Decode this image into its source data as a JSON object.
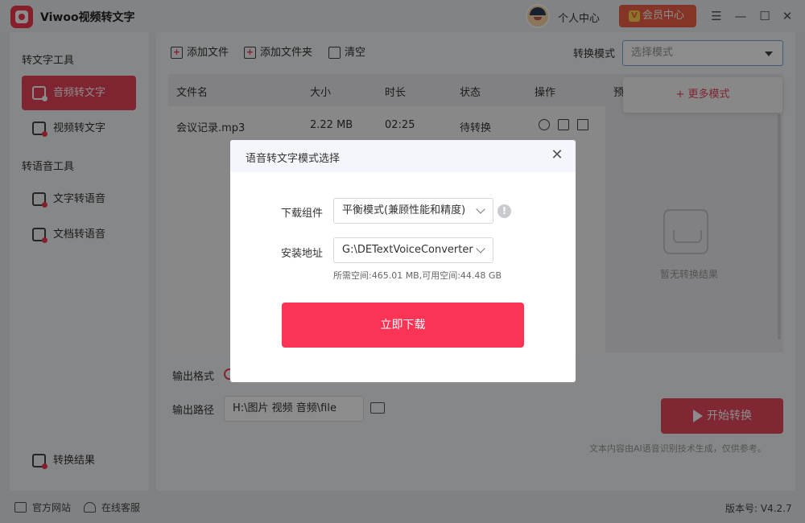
{
  "app": {
    "title": "Viwoo视频转文字"
  },
  "header": {
    "personal_center": "个人中心",
    "vip_center": "会员中心"
  },
  "sidebar": {
    "section_text_tools": "转文字工具",
    "section_voice_tools": "转语音工具",
    "items": [
      {
        "label": "音频转文字",
        "active": true
      },
      {
        "label": "视频转文字",
        "active": false
      },
      {
        "label": "文字转语音",
        "active": false
      },
      {
        "label": "文档转语音",
        "active": false
      }
    ],
    "results": "转换结果"
  },
  "toolbar": {
    "add_file": "添加文件",
    "add_folder": "添加文件夹",
    "clear": "清空"
  },
  "mode": {
    "label": "转换模式",
    "placeholder": "选择模式",
    "more": "+ 更多模式"
  },
  "table": {
    "headers": [
      "文件名",
      "大小",
      "时长",
      "状态",
      "操作"
    ],
    "rows": [
      {
        "name": "会议记录.mp3",
        "size": "2.22 MB",
        "duration": "02:25",
        "status": "待转换"
      }
    ]
  },
  "preview": {
    "title_fragment": "预",
    "empty": "暂无转换结果"
  },
  "output": {
    "format_label": "输出格式",
    "path_label": "输出路径",
    "path_value": "H:\\图片 视频 音频\\file"
  },
  "actions": {
    "start": "开始转换",
    "disclaimer": "文本内容由AI语音识别技术生成，仅供参考。"
  },
  "status_bar": {
    "website": "官方网站",
    "support": "在线客服",
    "version": "版本号: V4.2.7"
  },
  "dialog": {
    "title": "语音转文字模式选择",
    "component_label": "下载组件",
    "component_value": "平衡模式(兼顾性能和精度)",
    "path_label": "安装地址",
    "path_value": "G:\\DETextVoiceConverter",
    "space_info": "所需空间:465.01 MB,可用空间:44.48 GB",
    "download": "立即下载"
  },
  "colors": {
    "accent": "#e8425a",
    "button": "#fb3455",
    "vip": "#f0614a"
  }
}
